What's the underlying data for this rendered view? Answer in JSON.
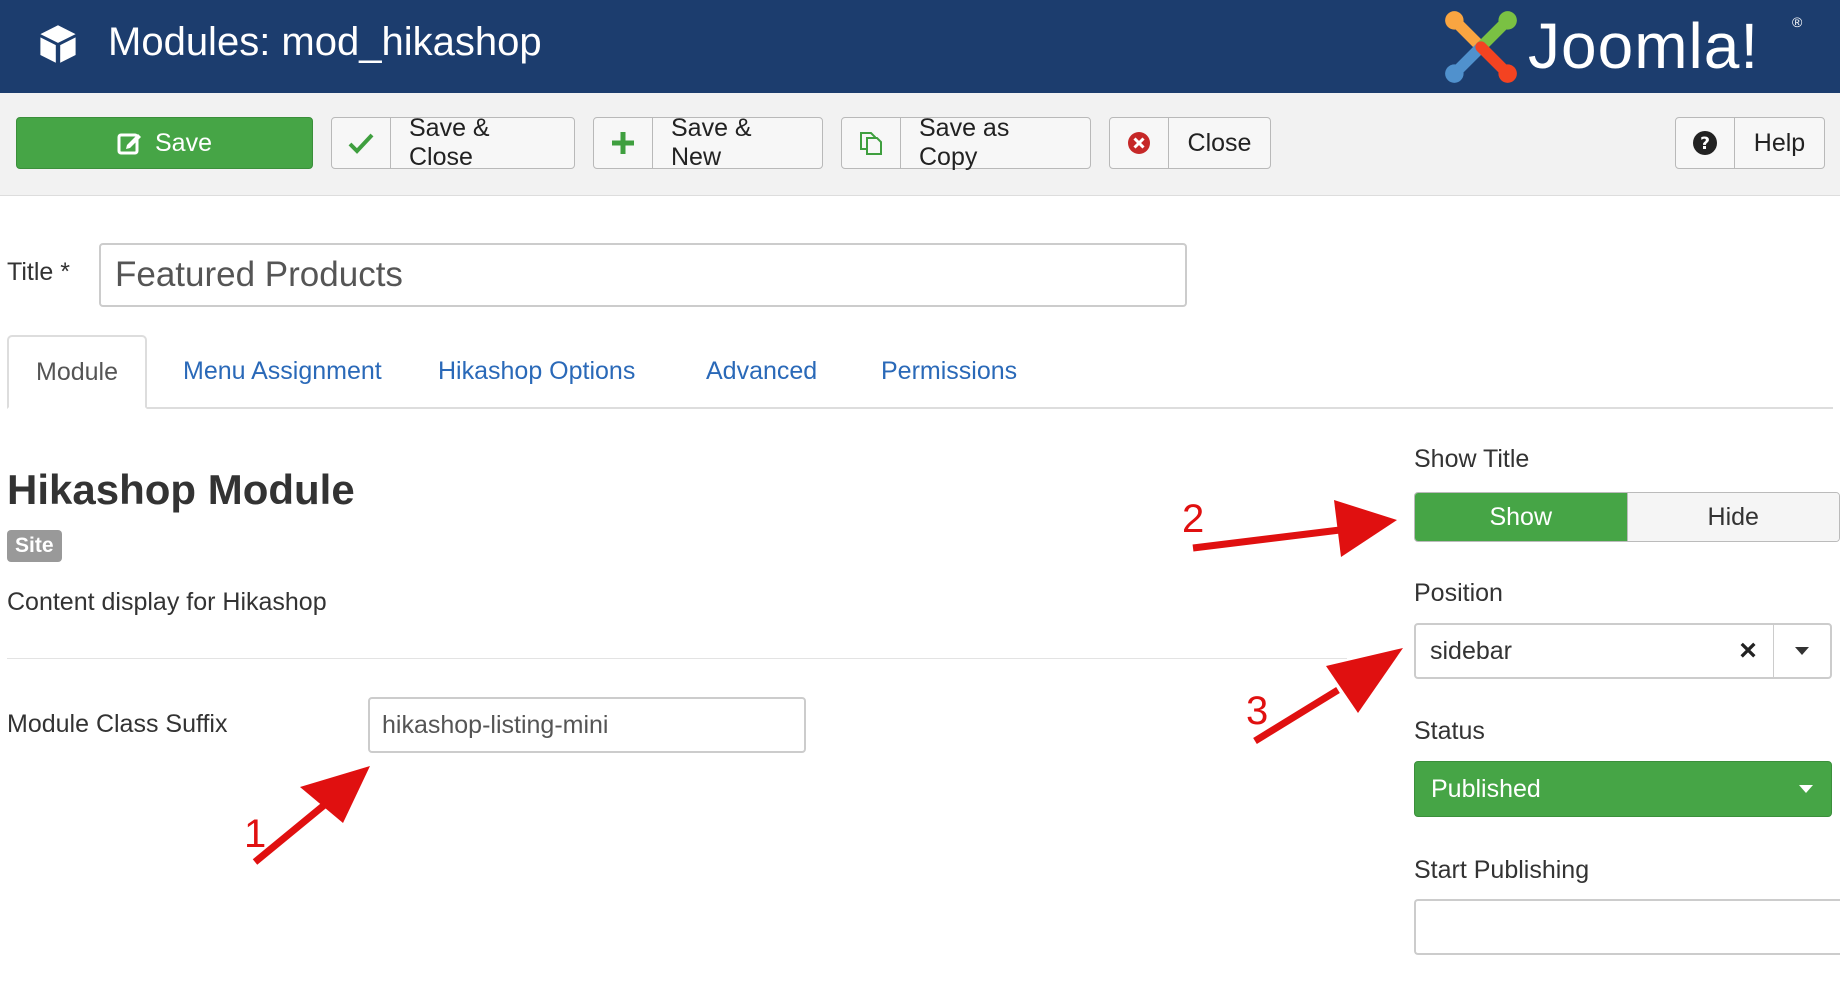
{
  "header": {
    "title": "Modules: mod_hikashop",
    "brand": "Joomla!",
    "brand_mark": "®"
  },
  "toolbar": {
    "save": "Save",
    "save_close": "Save & Close",
    "save_new": "Save & New",
    "save_copy": "Save as Copy",
    "close": "Close",
    "help": "Help"
  },
  "title_field": {
    "label": "Title *",
    "value": "Featured Products"
  },
  "tabs": [
    {
      "label": "Module"
    },
    {
      "label": "Menu Assignment"
    },
    {
      "label": "Hikashop Options"
    },
    {
      "label": "Advanced"
    },
    {
      "label": "Permissions"
    }
  ],
  "module": {
    "heading": "Hikashop Module",
    "badge": "Site",
    "description": "Content display for Hikashop",
    "suffix_label": "Module Class Suffix",
    "suffix_value": "hikashop-listing-mini"
  },
  "sidebar": {
    "show_title_label": "Show Title",
    "show": "Show",
    "hide": "Hide",
    "position_label": "Position",
    "position_value": "sidebar",
    "status_label": "Status",
    "status_value": "Published",
    "start_publishing_label": "Start Publishing"
  },
  "annotations": [
    "1",
    "2",
    "3"
  ],
  "colors": {
    "header": "#1c3d6e",
    "green": "#46a546",
    "link": "#2a69b8",
    "annotation": "#e01010"
  }
}
